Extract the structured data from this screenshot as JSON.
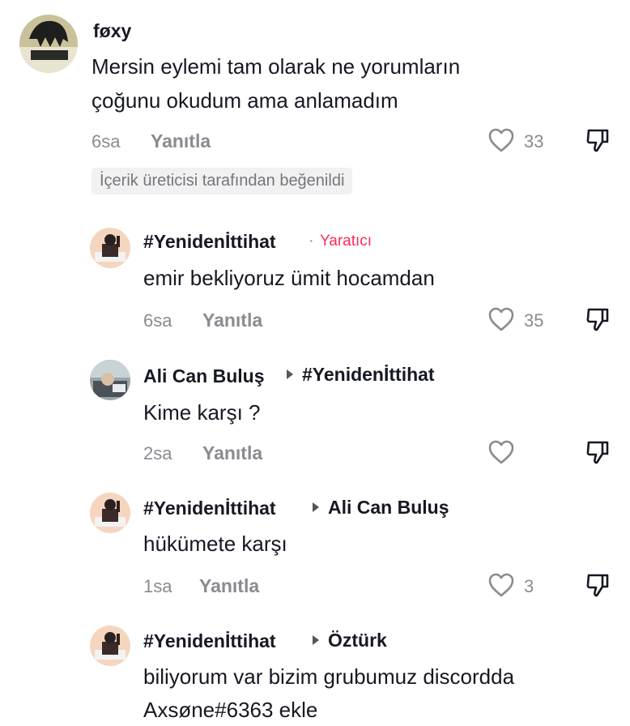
{
  "comments": [
    {
      "username": "føxy",
      "text_lines": [
        "Mersin eylemi tam olarak ne yorumların",
        "çoğunu okudum ama anlamadım"
      ],
      "time": "6sa",
      "reply_label": "Yanıtla",
      "likes": "33",
      "badge": "İçerik üreticisi tarafından beğenildi"
    }
  ],
  "replies": [
    {
      "username": "#Yenidenİttihat",
      "separator": "·",
      "creator_label": "Yaratıcı",
      "text_lines": [
        "emir bekliyoruz ümit hocamdan"
      ],
      "time": "6sa",
      "reply_label": "Yanıtla",
      "likes": "35"
    },
    {
      "username": "Ali Can Buluş",
      "reply_to": "#Yenidenİttihat",
      "text_lines": [
        "Kime karşı ?"
      ],
      "time": "2sa",
      "reply_label": "Yanıtla",
      "likes": ""
    },
    {
      "username": "#Yenidenİttihat",
      "reply_to": "Ali Can Buluş",
      "text_lines": [
        "hükümete karşı"
      ],
      "time": "1sa",
      "reply_label": "Yanıtla",
      "likes": "3"
    },
    {
      "username": "#Yenidenİttihat",
      "reply_to": "Öztürk",
      "text_lines": [
        "biliyorum var bizim grubumuz discordda",
        "Axsøne#6363 ekle"
      ]
    }
  ],
  "colors": {
    "creator_red": "#fe2c55",
    "meta_gray": "#8a8b91",
    "badge_bg": "#f1f1f2"
  },
  "icons": [
    "heart-icon",
    "dislike-icon",
    "reply-arrow-icon"
  ]
}
